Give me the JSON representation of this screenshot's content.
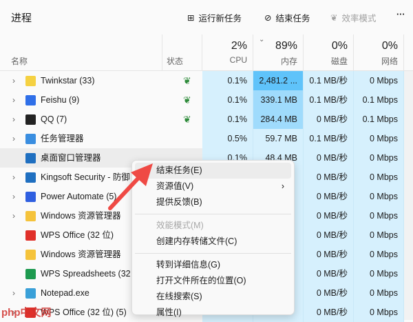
{
  "header": {
    "title": "进程",
    "run_task": "运行新任务",
    "end_task": "结束任务",
    "efficiency": "效率模式",
    "more": "···"
  },
  "columns": {
    "name": "名称",
    "status": "状态",
    "cpu": {
      "pct": "2%",
      "label": "CPU"
    },
    "mem": {
      "pct": "89%",
      "label": "内存"
    },
    "disk": {
      "pct": "0%",
      "label": "磁盘"
    },
    "net": {
      "pct": "0%",
      "label": "网络"
    }
  },
  "rows": [
    {
      "name": "Twinkstar (33)",
      "exp": true,
      "eco": true,
      "cpu": "0.1%",
      "mem": "2,481.2 ...",
      "disk": "0.1 MB/秒",
      "net": "0 Mbps",
      "icon": "#f5d142"
    },
    {
      "name": "Feishu (9)",
      "exp": true,
      "eco": true,
      "cpu": "0.1%",
      "mem": "339.1 MB",
      "disk": "0.1 MB/秒",
      "net": "0.1 Mbps",
      "icon": "#2f6fe8"
    },
    {
      "name": "QQ (7)",
      "exp": true,
      "eco": true,
      "cpu": "0.1%",
      "mem": "284.4 MB",
      "disk": "0 MB/秒",
      "net": "0.1 Mbps",
      "icon": "#222222"
    },
    {
      "name": "任务管理器",
      "exp": true,
      "eco": false,
      "cpu": "0.5%",
      "mem": "59.7 MB",
      "disk": "0.1 MB/秒",
      "net": "0 Mbps",
      "icon": "#3a8ee0"
    },
    {
      "name": "桌面窗口管理器",
      "exp": false,
      "eco": false,
      "cpu": "0.1%",
      "mem": "48.4 MB",
      "disk": "0 MB/秒",
      "net": "0 Mbps",
      "icon": "#1f6fc0"
    },
    {
      "name": "Kingsoft Security - 防御",
      "exp": true,
      "eco": false,
      "cpu": "",
      "mem": "",
      "disk": "0 MB/秒",
      "net": "0 Mbps",
      "icon": "#1f6fc0"
    },
    {
      "name": "Power Automate (5)",
      "exp": true,
      "eco": false,
      "cpu": "",
      "mem": "",
      "disk": "0 MB/秒",
      "net": "0 Mbps",
      "icon": "#2f5fe0"
    },
    {
      "name": "Windows 资源管理器",
      "exp": true,
      "eco": false,
      "cpu": "",
      "mem": "",
      "disk": "0 MB/秒",
      "net": "0 Mbps",
      "icon": "#f5c33b"
    },
    {
      "name": "WPS Office (32 位)",
      "exp": false,
      "eco": false,
      "cpu": "",
      "mem": "",
      "disk": "0 MB/秒",
      "net": "0 Mbps",
      "icon": "#e0302a"
    },
    {
      "name": "Windows 资源管理器",
      "exp": false,
      "eco": false,
      "cpu": "",
      "mem": "",
      "disk": "0 MB/秒",
      "net": "0 Mbps",
      "icon": "#f5c33b"
    },
    {
      "name": "WPS Spreadsheets (32",
      "exp": false,
      "eco": false,
      "cpu": "",
      "mem": "",
      "disk": "0 MB/秒",
      "net": "0 Mbps",
      "icon": "#1d9a4f"
    },
    {
      "name": "Notepad.exe",
      "exp": true,
      "eco": false,
      "cpu": "",
      "mem": "",
      "disk": "0 MB/秒",
      "net": "0 Mbps",
      "icon": "#3aa0d8"
    },
    {
      "name": "WPS Office (32 位) (5)",
      "exp": true,
      "eco": false,
      "cpu": "",
      "mem": "",
      "disk": "0 MB/秒",
      "net": "0 Mbps",
      "icon": "#e0302a"
    }
  ],
  "menu": [
    {
      "label": "结束任务(E)",
      "hl": true
    },
    {
      "label": "资源值(V)",
      "sub": true
    },
    {
      "label": "提供反馈(B)"
    },
    {
      "sep": true
    },
    {
      "label": "效能模式(M)",
      "dis": true
    },
    {
      "label": "创建内存转储文件(C)"
    },
    {
      "sep": true
    },
    {
      "label": "转到详细信息(G)"
    },
    {
      "label": "打开文件所在的位置(O)"
    },
    {
      "label": "在线搜索(S)"
    },
    {
      "label": "属性(I)"
    }
  ],
  "watermark": "php中文网"
}
